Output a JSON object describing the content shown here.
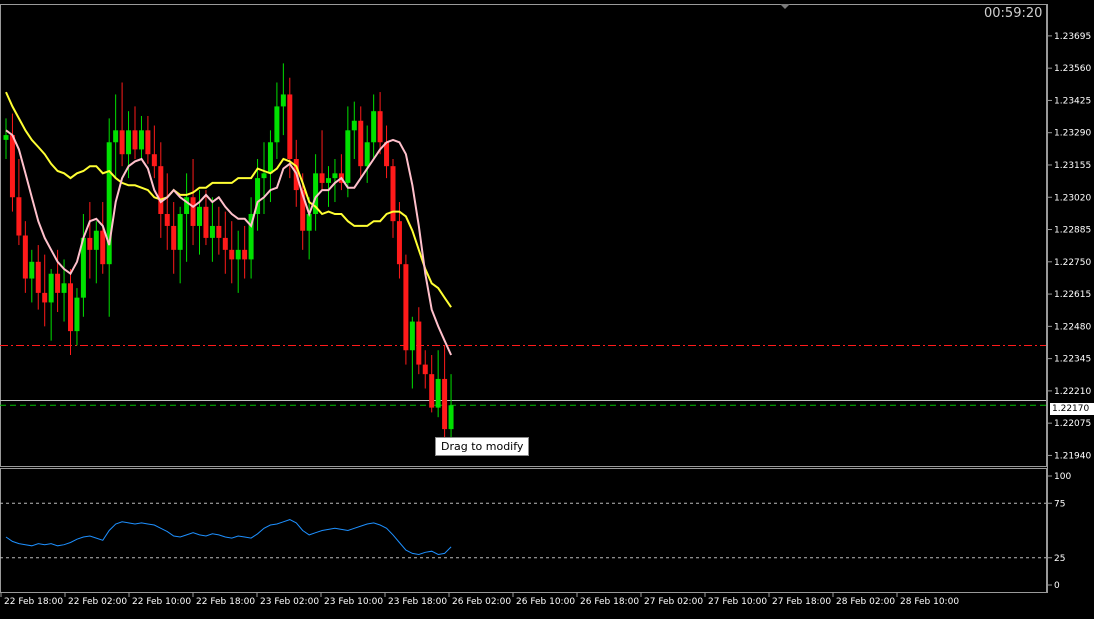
{
  "countdown": "00:59:20",
  "tooltip": "Drag to modify",
  "current_price": "1.22170",
  "colors": {
    "background": "#000000",
    "bull": "#00e000",
    "bear": "#ff1a1a",
    "ma_slow": "#ffff33",
    "ma_fast": "#ffc0cb",
    "rsi": "#1e90ff",
    "level_red": "#ff1a1a",
    "level_green": "#00c000",
    "bid_line": "#c0c0c0",
    "axis_text": "#ffffff"
  },
  "chart_data": [
    {
      "type": "candlestick",
      "symbol_panel": "main",
      "y_ticks": [
        "1.23695",
        "1.23560",
        "1.23425",
        "1.23290",
        "1.23155",
        "1.23020",
        "1.22885",
        "1.22750",
        "1.22615",
        "1.22480",
        "1.22345",
        "1.22210",
        "1.22075",
        "1.21940"
      ],
      "ylim": [
        1.219,
        1.2382
      ],
      "x_ticks": [
        "22 Feb 18:00",
        "22 Feb 02:00",
        "22 Feb 10:00",
        "22 Feb 18:00",
        "23 Feb 02:00",
        "23 Feb 10:00",
        "23 Feb 18:00",
        "26 Feb 02:00",
        "26 Feb 10:00",
        "26 Feb 18:00",
        "27 Feb 02:00",
        "27 Feb 10:00",
        "27 Feb 18:00",
        "28 Feb 02:00",
        "28 Feb 10:00"
      ],
      "horizontal_levels": [
        {
          "value": 1.224,
          "style": "dash-dot",
          "color": "red"
        },
        {
          "value": 1.2215,
          "style": "dashed",
          "color": "green"
        },
        {
          "value": 1.2217,
          "style": "solid",
          "color": "silver"
        }
      ],
      "ma_fast": [
        1.233,
        1.2328,
        1.2322,
        1.2312,
        1.2302,
        1.2292,
        1.2285,
        1.228,
        1.2275,
        1.2272,
        1.227,
        1.2275,
        1.2285,
        1.2292,
        1.2293,
        1.229,
        1.2282,
        1.23,
        1.231,
        1.2315,
        1.2317,
        1.2318,
        1.2314,
        1.2305,
        1.23,
        1.2302,
        1.2305,
        1.2302,
        1.23,
        1.2298,
        1.23,
        1.2303,
        1.23,
        1.2302,
        1.2298,
        1.2295,
        1.2293,
        1.2293,
        1.229,
        1.23,
        1.2302,
        1.2305,
        1.2306,
        1.2314,
        1.2316,
        1.2312,
        1.2303,
        1.2295,
        1.2302,
        1.2305,
        1.2305,
        1.2308,
        1.231,
        1.2306,
        1.2306,
        1.231,
        1.2314,
        1.2318,
        1.2322,
        1.2325,
        1.2326,
        1.2325,
        1.232,
        1.2307,
        1.229,
        1.227,
        1.2255,
        1.2248,
        1.2242,
        1.2236
      ],
      "ma_slow": [
        1.2346,
        1.234,
        1.2335,
        1.233,
        1.2326,
        1.2323,
        1.232,
        1.2316,
        1.2313,
        1.2312,
        1.231,
        1.2312,
        1.2313,
        1.2315,
        1.2315,
        1.2312,
        1.2313,
        1.231,
        1.2308,
        1.2307,
        1.2307,
        1.2306,
        1.2305,
        1.2302,
        1.2301,
        1.2302,
        1.2305,
        1.2303,
        1.2303,
        1.2304,
        1.2306,
        1.2306,
        1.2308,
        1.2308,
        1.2308,
        1.2308,
        1.231,
        1.231,
        1.231,
        1.2314,
        1.2313,
        1.2312,
        1.2314,
        1.2318,
        1.2317,
        1.2315,
        1.2308,
        1.23,
        1.2298,
        1.2295,
        1.2296,
        1.2295,
        1.2295,
        1.2292,
        1.229,
        1.229,
        1.229,
        1.2292,
        1.2292,
        1.2295,
        1.2296,
        1.2296,
        1.2294,
        1.2288,
        1.228,
        1.2272,
        1.2266,
        1.2264,
        1.226,
        1.2256
      ],
      "candles": [
        [
          1.2326,
          1.2335,
          1.2318,
          1.2328
        ],
        [
          1.2328,
          1.2337,
          1.2296,
          1.2302
        ],
        [
          1.2302,
          1.2318,
          1.2282,
          1.2286
        ],
        [
          1.2286,
          1.2292,
          1.2262,
          1.2268
        ],
        [
          1.2268,
          1.228,
          1.2258,
          1.2275
        ],
        [
          1.2275,
          1.2282,
          1.2255,
          1.2262
        ],
        [
          1.2262,
          1.2278,
          1.2248,
          1.2258
        ],
        [
          1.2258,
          1.2272,
          1.2242,
          1.227
        ],
        [
          1.227,
          1.228,
          1.2254,
          1.2262
        ],
        [
          1.2262,
          1.2276,
          1.225,
          1.2266
        ],
        [
          1.2266,
          1.2272,
          1.2236,
          1.2246
        ],
        [
          1.2246,
          1.2264,
          1.224,
          1.226
        ],
        [
          1.226,
          1.2295,
          1.2252,
          1.2285
        ],
        [
          1.2285,
          1.23,
          1.2268,
          1.228
        ],
        [
          1.228,
          1.2292,
          1.2266,
          1.2288
        ],
        [
          1.2288,
          1.23,
          1.227,
          1.2274
        ],
        [
          1.2274,
          1.2335,
          1.2252,
          1.2325
        ],
        [
          1.2325,
          1.2345,
          1.231,
          1.233
        ],
        [
          1.233,
          1.235,
          1.2315,
          1.232
        ],
        [
          1.232,
          1.2338,
          1.231,
          1.233
        ],
        [
          1.233,
          1.234,
          1.2318,
          1.2322
        ],
        [
          1.2322,
          1.2336,
          1.2318,
          1.233
        ],
        [
          1.233,
          1.2336,
          1.2316,
          1.232
        ],
        [
          1.232,
          1.2332,
          1.231,
          1.2315
        ],
        [
          1.2315,
          1.2325,
          1.2285,
          1.2295
        ],
        [
          1.2295,
          1.2312,
          1.228,
          1.229
        ],
        [
          1.229,
          1.23,
          1.227,
          1.228
        ],
        [
          1.228,
          1.2298,
          1.2266,
          1.2295
        ],
        [
          1.2295,
          1.2312,
          1.2275,
          1.2302
        ],
        [
          1.2302,
          1.2318,
          1.2282,
          1.229
        ],
        [
          1.229,
          1.2305,
          1.2278,
          1.2298
        ],
        [
          1.2298,
          1.2305,
          1.2282,
          1.2285
        ],
        [
          1.2285,
          1.2302,
          1.2275,
          1.229
        ],
        [
          1.229,
          1.2298,
          1.2278,
          1.2285
        ],
        [
          1.2285,
          1.2296,
          1.227,
          1.228
        ],
        [
          1.228,
          1.2292,
          1.2266,
          1.2276
        ],
        [
          1.2276,
          1.2288,
          1.2262,
          1.228
        ],
        [
          1.228,
          1.229,
          1.2268,
          1.2276
        ],
        [
          1.2276,
          1.2302,
          1.2268,
          1.2295
        ],
        [
          1.2295,
          1.2318,
          1.2288,
          1.231
        ],
        [
          1.231,
          1.2325,
          1.2295,
          1.2312
        ],
        [
          1.2312,
          1.233,
          1.23,
          1.2325
        ],
        [
          1.2325,
          1.235,
          1.2318,
          1.234
        ],
        [
          1.234,
          1.2358,
          1.2328,
          1.2345
        ],
        [
          1.2345,
          1.2352,
          1.231,
          1.2318
        ],
        [
          1.2318,
          1.2326,
          1.2298,
          1.2305
        ],
        [
          1.2305,
          1.2312,
          1.228,
          1.2288
        ],
        [
          1.2288,
          1.2302,
          1.2276,
          1.2295
        ],
        [
          1.2295,
          1.232,
          1.2288,
          1.2312
        ],
        [
          1.2312,
          1.233,
          1.2305,
          1.2308
        ],
        [
          1.2308,
          1.2315,
          1.2298,
          1.231
        ],
        [
          1.231,
          1.2318,
          1.23,
          1.2312
        ],
        [
          1.2312,
          1.232,
          1.2305,
          1.2308
        ],
        [
          1.2308,
          1.234,
          1.2302,
          1.233
        ],
        [
          1.233,
          1.2342,
          1.2318,
          1.2334
        ],
        [
          1.2334,
          1.234,
          1.231,
          1.2315
        ],
        [
          1.2315,
          1.2332,
          1.2308,
          1.2325
        ],
        [
          1.2325,
          1.2345,
          1.2318,
          1.2338
        ],
        [
          1.2338,
          1.2346,
          1.232,
          1.2325
        ],
        [
          1.2325,
          1.2332,
          1.231,
          1.2315
        ],
        [
          1.2315,
          1.2318,
          1.2285,
          1.2292
        ],
        [
          1.2292,
          1.23,
          1.2268,
          1.2274
        ],
        [
          1.2274,
          1.2278,
          1.2232,
          1.2238
        ],
        [
          1.2238,
          1.2252,
          1.2222,
          1.225
        ],
        [
          1.225,
          1.2256,
          1.2228,
          1.2232
        ],
        [
          1.2232,
          1.2238,
          1.2222,
          1.2228
        ],
        [
          1.2228,
          1.2236,
          1.2212,
          1.2214
        ],
        [
          1.2214,
          1.2238,
          1.221,
          1.2226
        ],
        [
          1.2226,
          1.224,
          1.2198,
          1.2205
        ],
        [
          1.2205,
          1.2228,
          1.22,
          1.2215
        ]
      ]
    },
    {
      "type": "line",
      "symbol_panel": "rsi",
      "y_ticks": [
        "100",
        "75",
        "25",
        "0"
      ],
      "ylim": [
        0,
        100
      ],
      "levels": [
        75,
        25
      ],
      "values": [
        44,
        40,
        38,
        37,
        36,
        38,
        37,
        38,
        36,
        37,
        39,
        42,
        44,
        45,
        43,
        41,
        50,
        56,
        58,
        57,
        56,
        57,
        56,
        55,
        52,
        49,
        45,
        44,
        46,
        48,
        46,
        45,
        47,
        46,
        44,
        43,
        45,
        44,
        43,
        47,
        52,
        55,
        56,
        58,
        60,
        57,
        50,
        46,
        48,
        50,
        51,
        52,
        51,
        50,
        52,
        54,
        56,
        57,
        55,
        52,
        46,
        39,
        32,
        29,
        28,
        30,
        31,
        28,
        29,
        35
      ]
    }
  ]
}
